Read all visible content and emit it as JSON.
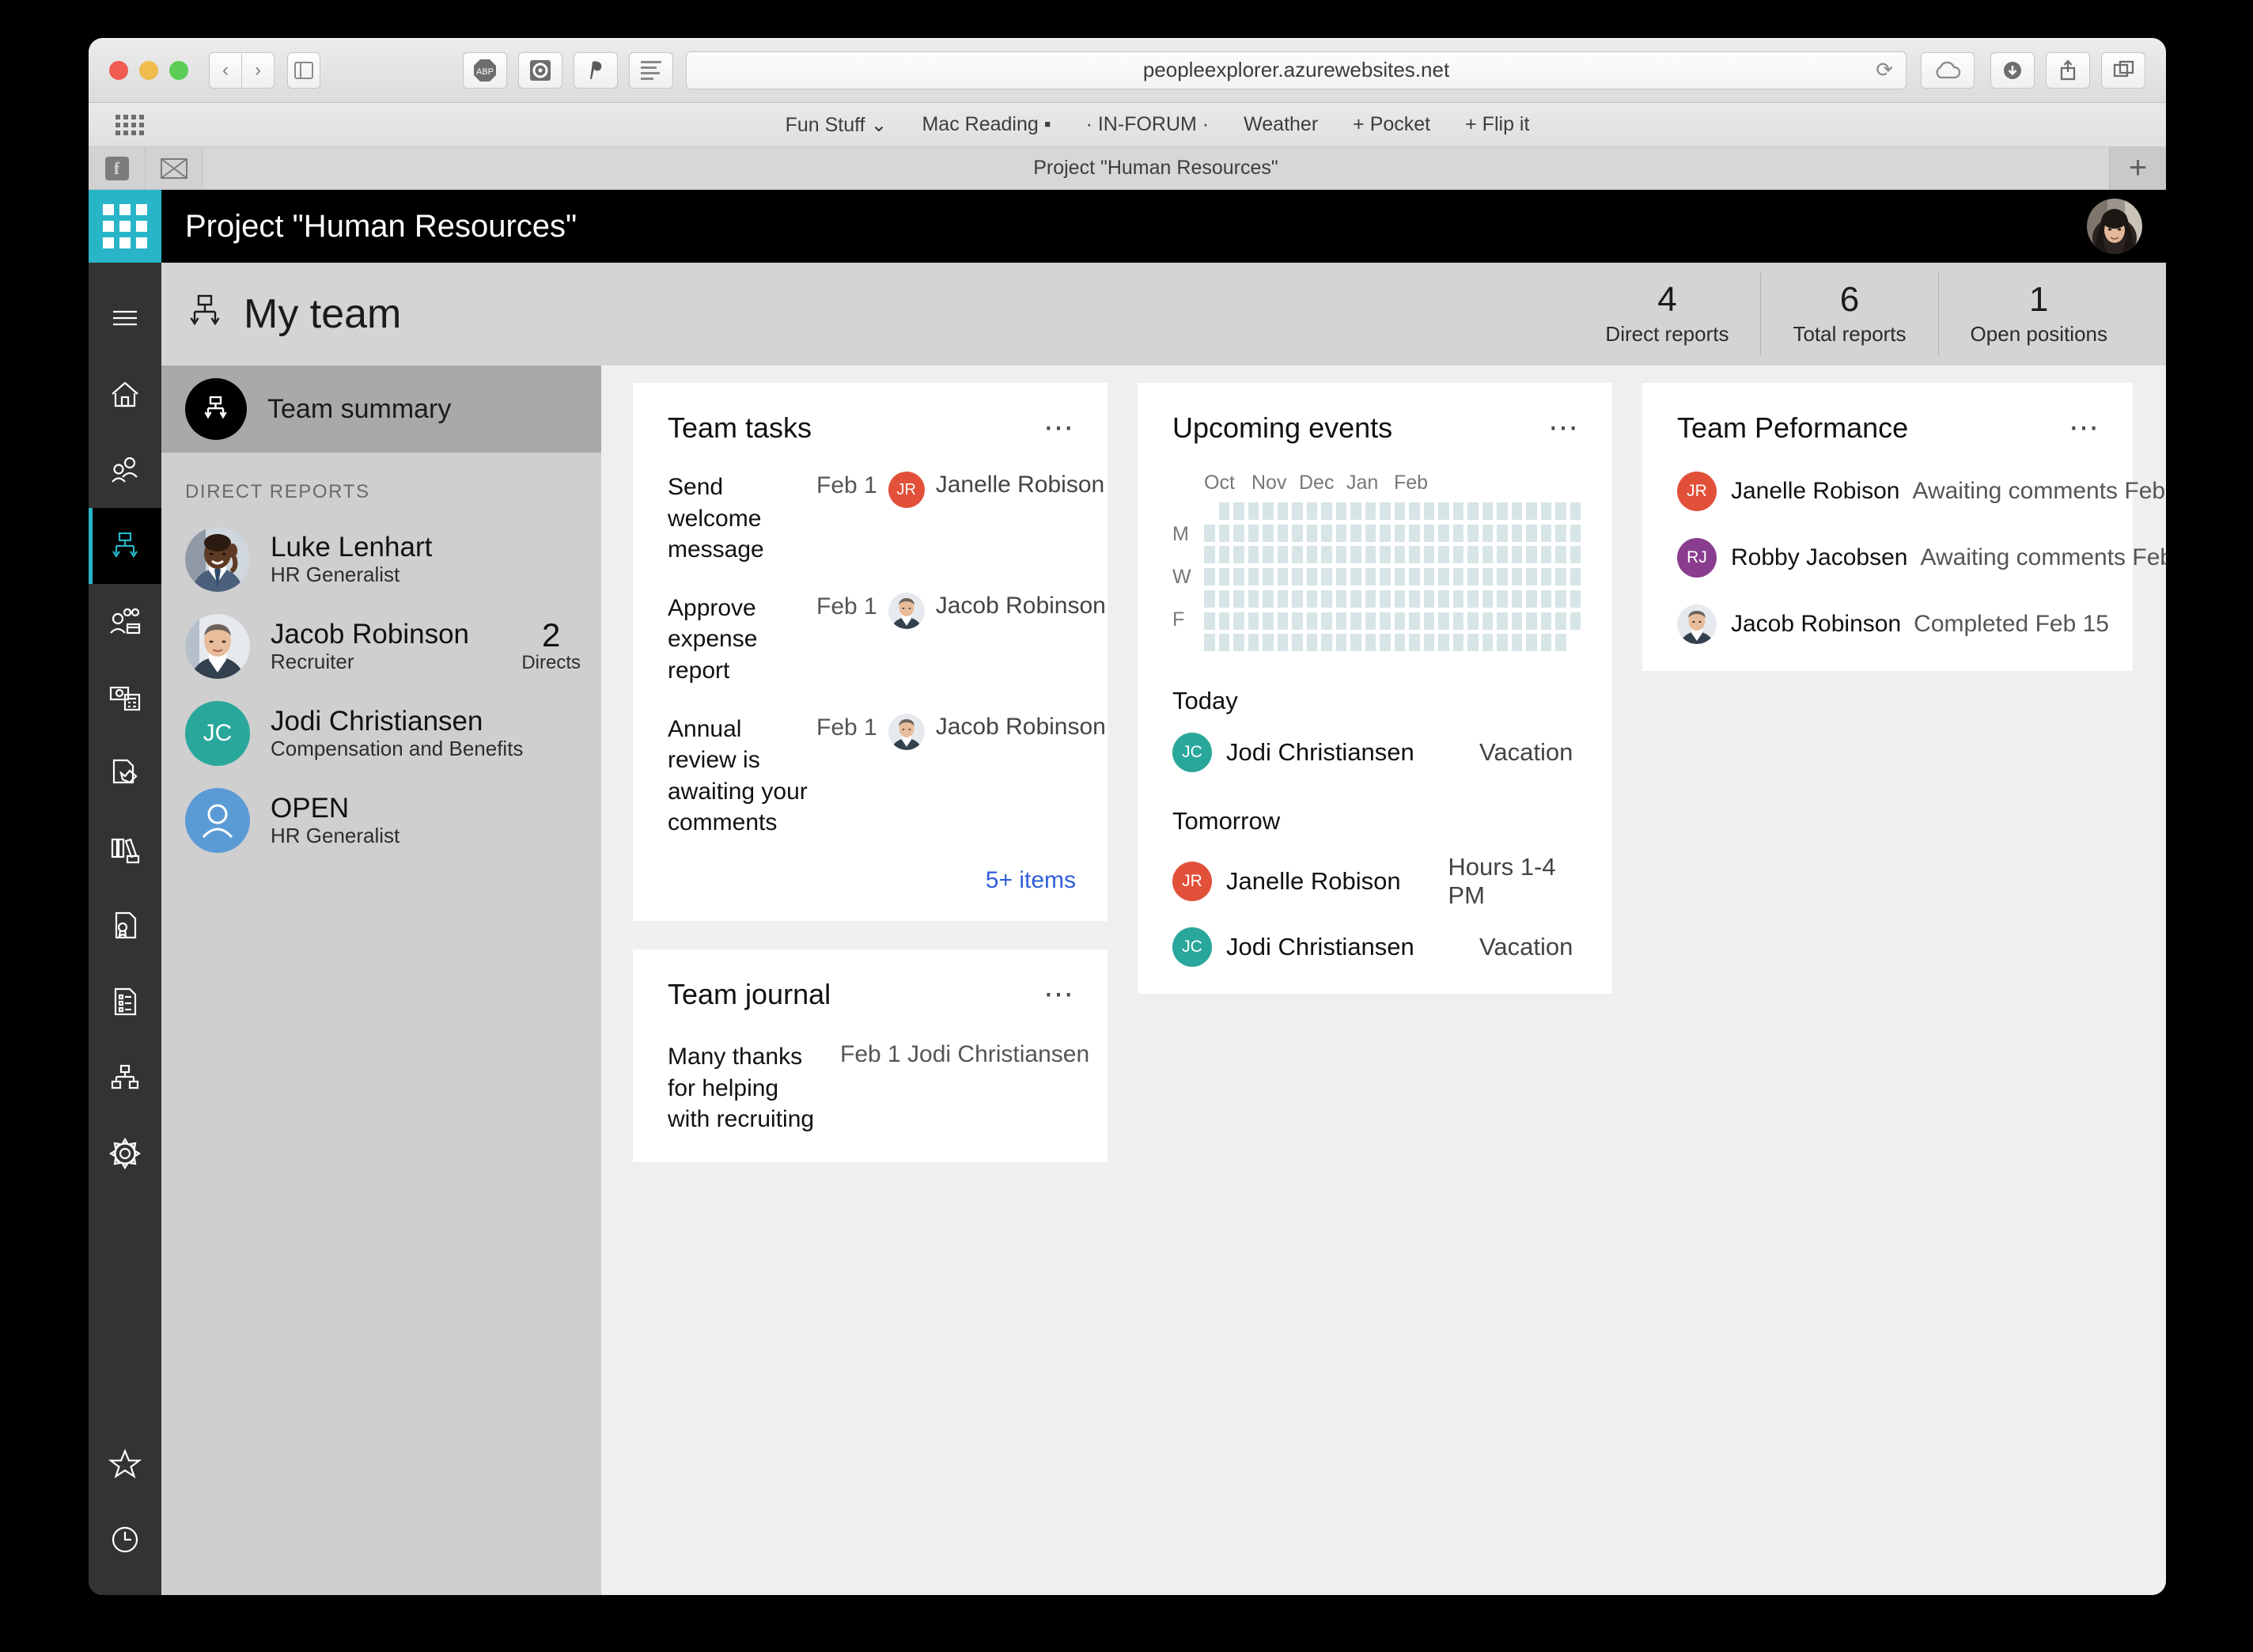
{
  "browser": {
    "url": "peopleexplorer.azurewebsites.net",
    "reload_icon": "reload-icon",
    "cloud_icon": "cloud-icon",
    "back_icon": "back-arrow-icon",
    "forward_icon": "forward-arrow-icon",
    "sidebar_icon": "sidebar-toggle-icon",
    "extensions": [
      "ABP",
      "ghostery-icon",
      "pinterest-icon",
      "reader-list-icon"
    ],
    "download_icon": "download-icon",
    "share_icon": "share-icon",
    "tabs_icon": "show-all-tabs-icon",
    "newtab_label": "+",
    "bookmarks": [
      {
        "label": "Fun Stuff ⌄"
      },
      {
        "label": "Mac Reading ▪"
      },
      {
        "label": "· IN-FORUM ·"
      },
      {
        "label": "Weather"
      },
      {
        "label": "+ Pocket"
      },
      {
        "label": "+ Flip it"
      }
    ],
    "tab_title": "Project \"Human Resources\"",
    "fav_buttons": [
      "facebook-icon",
      "mail-icon"
    ]
  },
  "app": {
    "title": "Project \"Human Resources\"",
    "accent": "#28b5c8",
    "waffle_icon": "app-launcher-icon",
    "user_avatar": "user-avatar"
  },
  "rail": {
    "items": [
      {
        "name": "hamburger-menu-icon",
        "active": false
      },
      {
        "name": "home-icon",
        "active": false
      },
      {
        "name": "people-icon",
        "active": false
      },
      {
        "name": "org-chart-icon",
        "active": true
      },
      {
        "name": "team-briefcase-icon",
        "active": false
      },
      {
        "name": "payroll-icon",
        "active": false
      },
      {
        "name": "document-chart-icon",
        "active": false
      },
      {
        "name": "books-icon",
        "active": false
      },
      {
        "name": "certificate-icon",
        "active": false
      },
      {
        "name": "list-document-icon",
        "active": false
      },
      {
        "name": "hierarchy-icon",
        "active": false
      },
      {
        "name": "gear-icon",
        "active": false
      }
    ],
    "bottom_items": [
      {
        "name": "star-icon"
      },
      {
        "name": "clock-icon"
      }
    ]
  },
  "page": {
    "title": "My team",
    "title_icon": "org-chart-icon",
    "stats": [
      {
        "value": "4",
        "label": "Direct reports"
      },
      {
        "value": "6",
        "label": "Total reports"
      },
      {
        "value": "1",
        "label": "Open positions"
      }
    ]
  },
  "panel": {
    "team_summary_label": "Team summary",
    "team_summary_icon": "org-chart-icon",
    "section_label": "DIRECT REPORTS",
    "reports": [
      {
        "name": "Luke Lenhart",
        "role": "HR Generalist",
        "avatar_type": "photo",
        "photo": "man-on-phone",
        "directs": "",
        "directs_label": ""
      },
      {
        "name": "Jacob Robinson",
        "role": "Recruiter",
        "avatar_type": "photo",
        "photo": "man-gray-hair",
        "directs": "2",
        "directs_label": "Directs"
      },
      {
        "name": "Jodi Christiansen",
        "role": "Compensation and Benefits",
        "avatar_type": "initials",
        "initials": "JC",
        "color": "#2aa79b",
        "directs": "",
        "directs_label": ""
      },
      {
        "name": "OPEN",
        "role": "HR Generalist",
        "avatar_type": "person-icon",
        "color": "#5b9bd5",
        "directs": "",
        "directs_label": ""
      }
    ]
  },
  "cards": {
    "team_tasks": {
      "title": "Team tasks",
      "menu_icon": "overflow-menu-icon",
      "items": [
        {
          "text": "Send welcome message",
          "date": "Feb 1",
          "person": "Janelle Robison",
          "avatar_type": "initials",
          "initials": "JR",
          "color": "#e2503a"
        },
        {
          "text": "Approve expense report",
          "date": "Feb 1",
          "person": "Jacob Robinson",
          "avatar_type": "photo",
          "photo": "man-gray-hair"
        },
        {
          "text": "Annual review is awaiting your comments",
          "date": "Feb 1",
          "person": "Jacob Robinson",
          "avatar_type": "photo",
          "photo": "man-gray-hair"
        }
      ],
      "footer_link": "5+ items"
    },
    "team_journal": {
      "title": "Team journal",
      "menu_icon": "overflow-menu-icon",
      "items": [
        {
          "text": "Many thanks for helping with recruiting",
          "meta": "Feb 1 Jodi Christiansen"
        }
      ]
    },
    "upcoming_events": {
      "title": "Upcoming events",
      "menu_icon": "overflow-menu-icon",
      "heatmap": {
        "months": [
          "Oct",
          "Nov",
          "Dec",
          "Jan",
          "Feb"
        ],
        "day_labels": [
          "",
          "M",
          "",
          "W",
          "",
          "F",
          ""
        ],
        "rows": 7,
        "columns": 26,
        "cell_color": "#d7e5e7"
      },
      "groups": [
        {
          "label": "Today",
          "rows": [
            {
              "name": "Jodi Christiansen",
              "detail": "Vacation",
              "avatar_type": "initials",
              "initials": "JC",
              "color": "#2aa79b"
            }
          ]
        },
        {
          "label": "Tomorrow",
          "rows": [
            {
              "name": "Janelle Robison",
              "detail": "Hours 1-4 PM",
              "avatar_type": "initials",
              "initials": "JR",
              "color": "#e2503a"
            },
            {
              "name": "Jodi Christiansen",
              "detail": "Vacation",
              "avatar_type": "initials",
              "initials": "JC",
              "color": "#2aa79b"
            }
          ]
        }
      ]
    },
    "team_performance": {
      "title": "Team Peformance",
      "menu_icon": "overflow-menu-icon",
      "rows": [
        {
          "name": "Janelle Robison",
          "status": "Awaiting comments Feb",
          "avatar_type": "initials",
          "initials": "JR",
          "color": "#e2503a"
        },
        {
          "name": "Robby Jacobsen",
          "status": "Awaiting comments Feb",
          "avatar_type": "initials",
          "initials": "RJ",
          "color": "#8a3d8f"
        },
        {
          "name": "Jacob Robinson",
          "status": "Completed Feb 15",
          "avatar_type": "photo",
          "photo": "man-gray-hair"
        }
      ]
    }
  }
}
